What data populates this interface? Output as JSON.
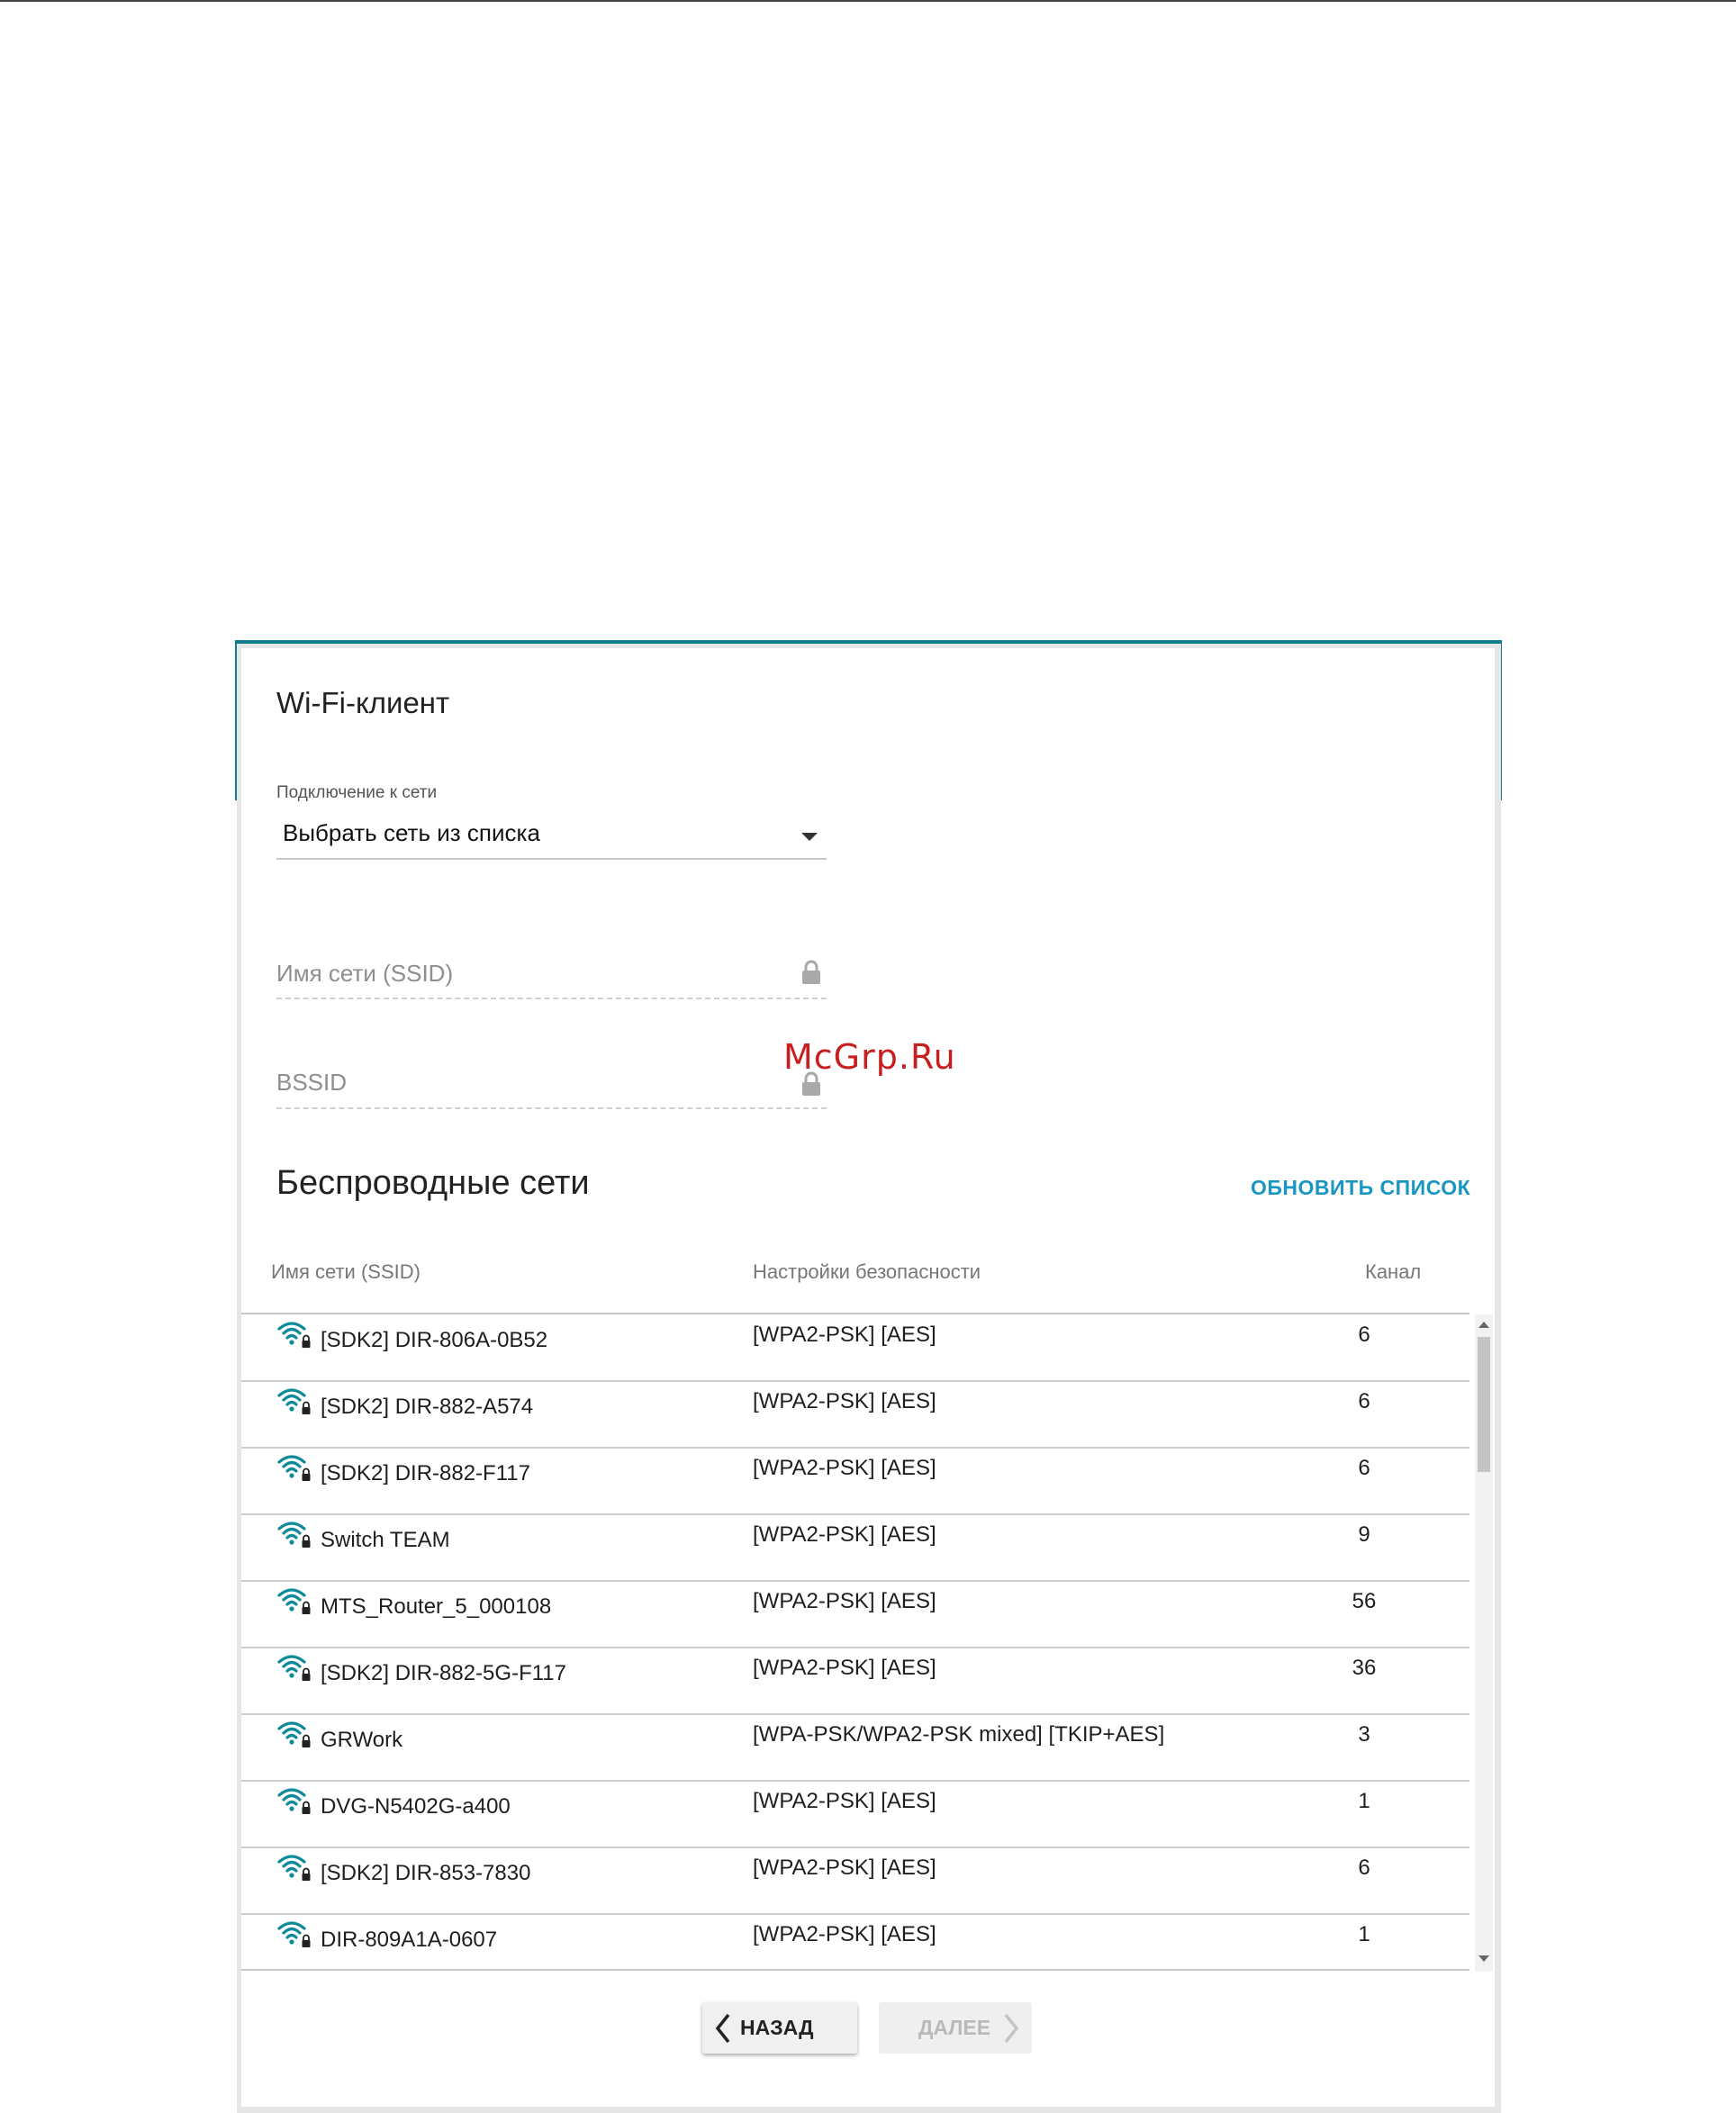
{
  "watermark": "McGrp.Ru",
  "page": {
    "title": "Wi-Fi-клиент"
  },
  "connection": {
    "label": "Подключение к сети",
    "value": "Выбрать сеть из списка"
  },
  "ssid_field": {
    "placeholder": "Имя сети (SSID)",
    "icon": "lock-icon"
  },
  "bssid_field": {
    "placeholder": "BSSID",
    "icon": "lock-icon"
  },
  "networks_section": {
    "title": "Беспроводные сети",
    "refresh_label": "ОБНОВИТЬ СПИСОК",
    "columns": {
      "ssid": "Имя сети (SSID)",
      "security": "Настройки безопасности",
      "channel": "Канал"
    },
    "rows": [
      {
        "ssid": "[SDK2] DIR-806A-0B52",
        "security": "[WPA2-PSK] [AES]",
        "channel": "6"
      },
      {
        "ssid": "[SDK2] DIR-882-A574",
        "security": "[WPA2-PSK] [AES]",
        "channel": "6"
      },
      {
        "ssid": "[SDK2] DIR-882-F117",
        "security": "[WPA2-PSK] [AES]",
        "channel": "6"
      },
      {
        "ssid": "Switch TEAM",
        "security": "[WPA2-PSK] [AES]",
        "channel": "9"
      },
      {
        "ssid": "MTS_Router_5_000108",
        "security": "[WPA2-PSK] [AES]",
        "channel": "56"
      },
      {
        "ssid": "[SDK2] DIR-882-5G-F117",
        "security": "[WPA2-PSK] [AES]",
        "channel": "36"
      },
      {
        "ssid": "GRWork",
        "security": "[WPA-PSK/WPA2-PSK mixed] [TKIP+AES]",
        "channel": "3"
      },
      {
        "ssid": "DVG-N5402G-a400",
        "security": "[WPA2-PSK] [AES]",
        "channel": "1"
      },
      {
        "ssid": "[SDK2] DIR-853-7830",
        "security": "[WPA2-PSK] [AES]",
        "channel": "6"
      },
      {
        "ssid": "DIR-809A1A-0607",
        "security": "[WPA2-PSK] [AES]",
        "channel": "1"
      }
    ]
  },
  "buttons": {
    "back_label": "НАЗАД",
    "next_label": "ДАЛЕЕ"
  },
  "colors": {
    "accent": "#0f7f8f",
    "link": "#1a96c3",
    "watermark": "#c81e1e",
    "wifi_icon": "#0f8a9a"
  }
}
